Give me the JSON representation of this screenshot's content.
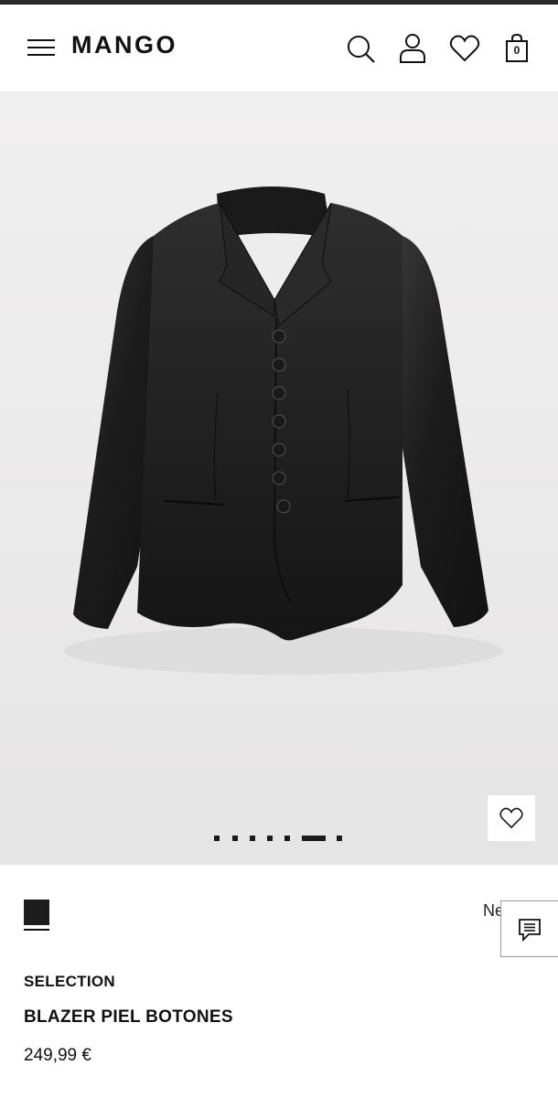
{
  "header": {
    "logo": "MANGO",
    "icons": [
      "menu-icon",
      "search-icon",
      "user-icon",
      "heart-icon",
      "bag-icon"
    ],
    "cart_count": "0"
  },
  "gallery": {
    "image_subject": "black leather blazer with buttons",
    "slide_count": 7,
    "active_slide": 6
  },
  "product": {
    "color_name": "Negro",
    "swatch_color": "#1d1d1d",
    "brand_line": "SELECTION",
    "name": "BLAZER PIEL BOTONES",
    "price": "249,99 €"
  },
  "colors": {
    "accent": "#111111",
    "background": "#ffffff",
    "gallery_bg": "#ebeaea"
  }
}
